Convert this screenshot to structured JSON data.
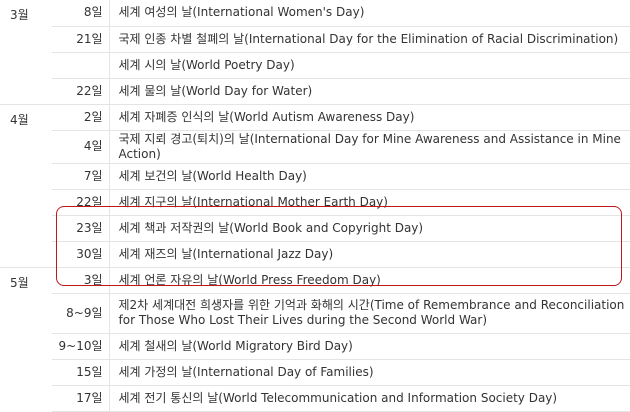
{
  "months": [
    {
      "month": "3월",
      "rows": [
        {
          "day": "8일",
          "desc": "세계 여성의 날(International Women's Day)"
        },
        {
          "day": "21일",
          "desc": "국제 인종 차별 철폐의 날(International Day for the Elimination of Racial Discrimination)"
        },
        {
          "day": "",
          "desc": "세계 시의 날(World Poetry Day)"
        },
        {
          "day": "22일",
          "desc": "세계 물의 날(World Day for Water)"
        }
      ]
    },
    {
      "month": "4월",
      "rows": [
        {
          "day": "2일",
          "desc": "세계 자폐증 인식의 날(World Autism Awareness Day)"
        },
        {
          "day": "4일",
          "desc": "국제 지뢰 경고(퇴치)의 날(International Day for Mine Awareness and Assistance in Mine Action)"
        },
        {
          "day": "7일",
          "desc": "세계 보건의 날(World Health Day)"
        },
        {
          "day": "22일",
          "desc": "세계 지구의 날(International Mother Earth Day)"
        },
        {
          "day": "23일",
          "desc": "세계 책과 저작권의 날(World Book and Copyright Day)"
        },
        {
          "day": "30일",
          "desc": "세계 재즈의 날(International Jazz Day)"
        }
      ]
    },
    {
      "month": "5월",
      "rows": [
        {
          "day": "3일",
          "desc": "세계 언론 자유의 날(World Press Freedom Day)"
        },
        {
          "day": "8~9일",
          "desc": "제2차 세계대전 희생자를 위한 기억과 화해의 시간(Time of Remembrance and Reconciliation for Those Who Lost Their Lives during the Second World War)"
        },
        {
          "day": "9~10일",
          "desc": "세계 철새의 날(World Migratory Bird Day)"
        },
        {
          "day": "15일",
          "desc": "세계 가정의 날(International Day of Families)"
        },
        {
          "day": "17일",
          "desc": "세계 전기 통신의 날(World Telecommunication and Information Society Day)"
        }
      ]
    }
  ],
  "highlight_color": "#c0171a"
}
